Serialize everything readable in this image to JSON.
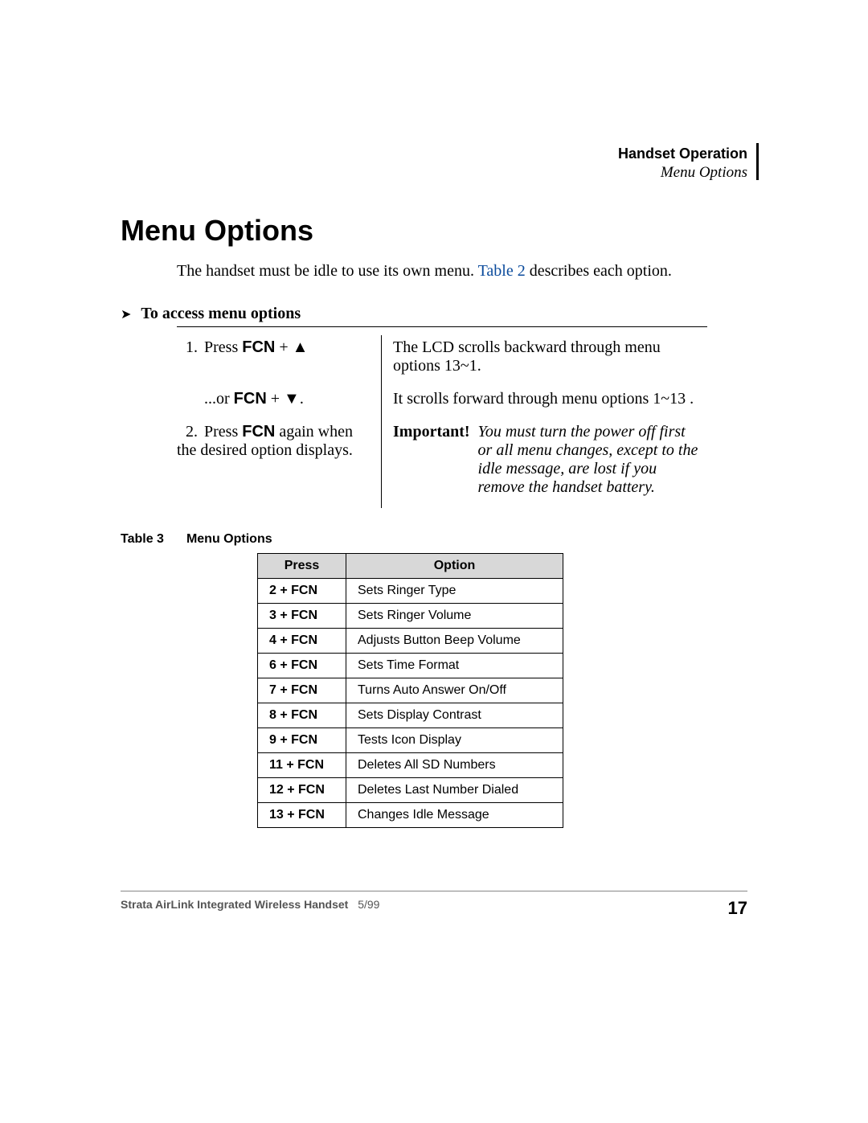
{
  "header": {
    "title": "Handset Operation",
    "subtitle": "Menu Options"
  },
  "section_title": "Menu Options",
  "intro": {
    "pre": "The handset must be idle to use its own menu. ",
    "link": "Table 2",
    "post": " describes each option."
  },
  "subheading": "To access menu options",
  "steps": {
    "r1": {
      "num": "1.",
      "left_pre": "Press ",
      "left_fcn": "FCN",
      "left_post": " + ▲",
      "right": "The LCD scrolls backward through menu options 13~1."
    },
    "r2": {
      "left_pre": "...or ",
      "left_fcn": "FCN",
      "left_post": " + ▼.",
      "right": "It scrolls forward through menu options 1~13 ."
    },
    "r3": {
      "num": "2.",
      "left_pre": "Press ",
      "left_fcn": "FCN",
      "left_post": " again when the desired option displays.",
      "imp_label": "Important!",
      "imp_text": "You must turn the power off first or all menu changes, except to the idle message, are lost if you remove the handset battery."
    }
  },
  "table_caption": {
    "label": "Table 3",
    "title": "Menu Options"
  },
  "table_headers": {
    "press": "Press",
    "option": "Option"
  },
  "table_rows": [
    {
      "press": "2 + FCN",
      "option": "Sets Ringer Type"
    },
    {
      "press": "3 + FCN",
      "option": "Sets Ringer Volume"
    },
    {
      "press": "4 + FCN",
      "option": "Adjusts Button Beep Volume"
    },
    {
      "press": "6 + FCN",
      "option": "Sets Time Format"
    },
    {
      "press": "7 + FCN",
      "option": "Turns Auto Answer On/Off"
    },
    {
      "press": "8 + FCN",
      "option": "Sets Display Contrast"
    },
    {
      "press": "9 + FCN",
      "option": "Tests Icon Display"
    },
    {
      "press": "11 + FCN",
      "option": "Deletes All SD Numbers"
    },
    {
      "press": "12 + FCN",
      "option": "Deletes Last Number Dialed"
    },
    {
      "press": "13 + FCN",
      "option": "Changes Idle Message"
    }
  ],
  "footer": {
    "doc": "Strata AirLink Integrated Wireless Handset",
    "date": "5/99",
    "page": "17"
  }
}
